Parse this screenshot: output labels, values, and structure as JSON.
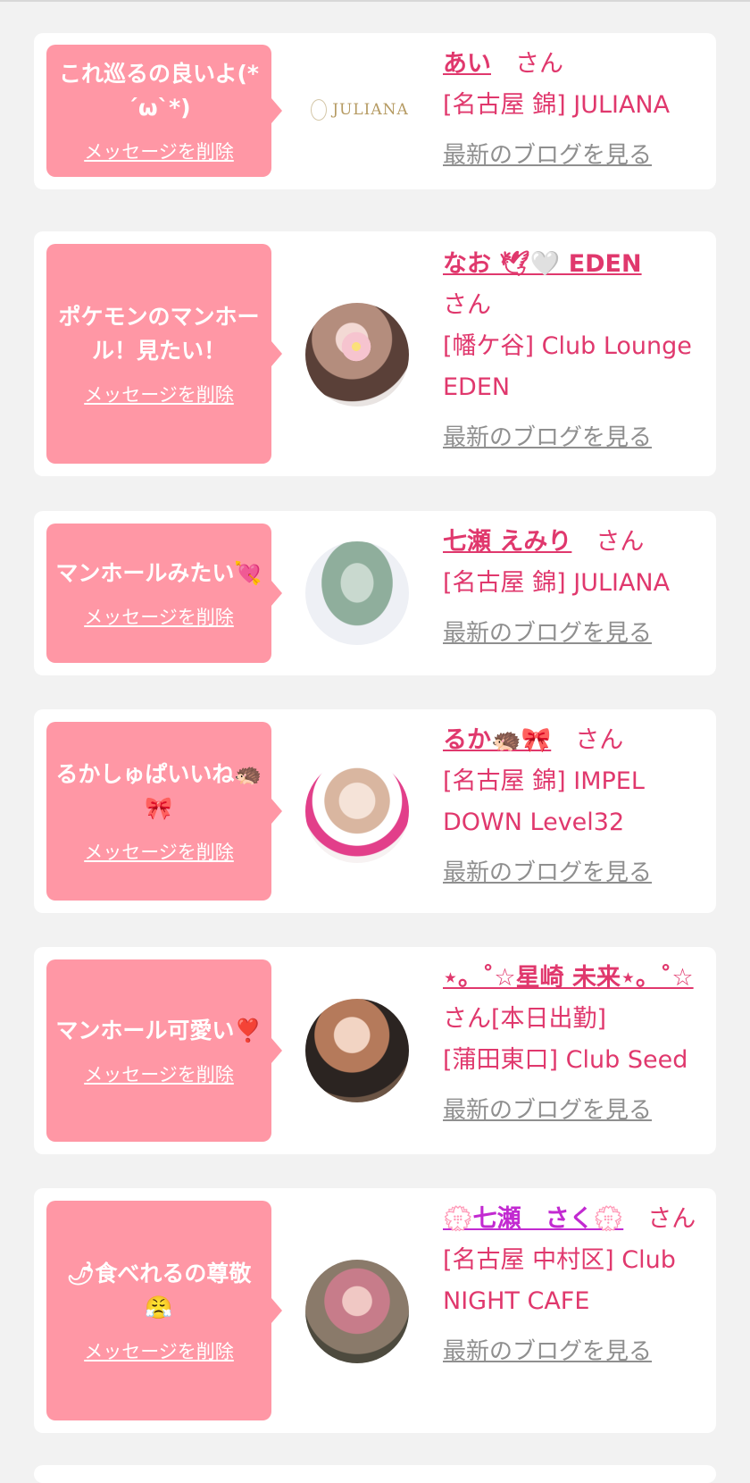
{
  "delete_label": "メッセージを削除",
  "blog_label": "最新のブログを見る",
  "colors": {
    "bubble": "#ff97a5",
    "accent": "#e0386d",
    "link_gray": "#8f8f8f",
    "background": "#f2f2f2"
  },
  "logo_text": "JULIANA",
  "cards": [
    {
      "message": "これ巡るの良いよ(*´ω`*)",
      "name": "あい",
      "honorific": "さん",
      "shop": "[名古屋 錦] JULIANA"
    },
    {
      "message": "ポケモンのマンホール！見たい！",
      "name": "なお 🕊🤍 EDEN",
      "honorific": "さん",
      "shop": "[幡ケ谷] Club Lounge EDEN"
    },
    {
      "message": "マンホールみたい💘",
      "name": "七瀬 えみり",
      "honorific": "さん",
      "shop": "[名古屋 錦] JULIANA"
    },
    {
      "message": "るかしゅぱいいね🦔🎀",
      "name": "るか🦔🎀",
      "honorific": "さん",
      "shop": "[名古屋 錦] IMPEL DOWN Level32"
    },
    {
      "message": "マンホール可愛い❣️",
      "name": "⋆。˚☆星崎 未来⋆。˚☆",
      "honorific": "さん[本日出勤]",
      "shop": "[蒲田東口] Club Seed"
    },
    {
      "message": "🌶食べれるの尊敬😤",
      "name": "💮七瀬　さく💮",
      "honorific": "さん",
      "shop": "[名古屋 中村区] Club NIGHT CAFE"
    }
  ]
}
